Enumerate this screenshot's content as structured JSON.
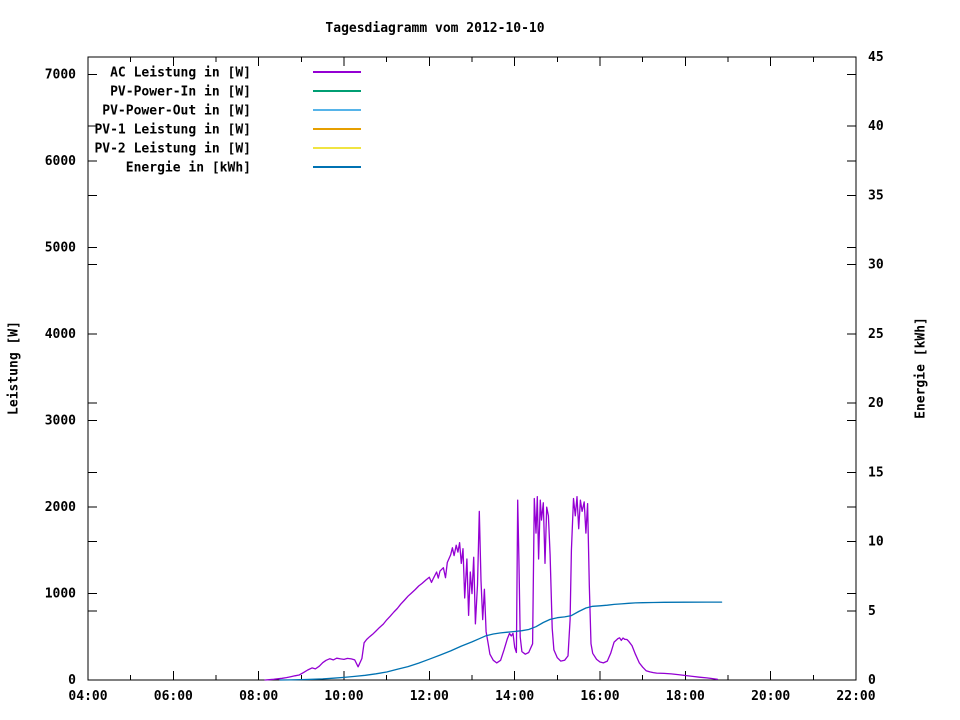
{
  "title": "Tagesdiagramm vom 2012-10-10",
  "chart_data": {
    "type": "line",
    "title": "Tagesdiagramm vom 2012-10-10",
    "grid": false,
    "legend_position": "top-left-inside",
    "x_axis": {
      "unit": "time of day",
      "range_hours": [
        4,
        22
      ],
      "major_tick_step_hours": 2,
      "minor_tick_step_hours": 1,
      "tick_labels": [
        "04:00",
        "06:00",
        "08:00",
        "10:00",
        "12:00",
        "14:00",
        "16:00",
        "18:00",
        "20:00",
        "22:00"
      ]
    },
    "y_left": {
      "label": "Leistung [W]",
      "range": [
        0,
        7200
      ],
      "tick_step": 1000,
      "tick_labels": [
        "0",
        "1000",
        "2000",
        "3000",
        "4000",
        "5000",
        "6000",
        "7000"
      ]
    },
    "y_right": {
      "label": "Energie [kWh]",
      "range": [
        0,
        45
      ],
      "tick_step": 5,
      "tick_labels": [
        "0",
        "5",
        "10",
        "15",
        "20",
        "25",
        "30",
        "35",
        "40",
        "45"
      ]
    },
    "series": [
      {
        "name": "AC Leistung in [W]",
        "color": "#9400D3",
        "axis": "left",
        "points": [
          [
            8.15,
            0
          ],
          [
            8.25,
            3
          ],
          [
            8.35,
            8
          ],
          [
            8.45,
            14
          ],
          [
            8.55,
            20
          ],
          [
            8.65,
            28
          ],
          [
            8.75,
            38
          ],
          [
            8.85,
            48
          ],
          [
            8.95,
            58
          ],
          [
            9.05,
            85
          ],
          [
            9.15,
            115
          ],
          [
            9.25,
            140
          ],
          [
            9.33,
            128
          ],
          [
            9.42,
            160
          ],
          [
            9.5,
            200
          ],
          [
            9.58,
            228
          ],
          [
            9.67,
            246
          ],
          [
            9.75,
            232
          ],
          [
            9.83,
            252
          ],
          [
            9.92,
            244
          ],
          [
            10.0,
            238
          ],
          [
            10.08,
            250
          ],
          [
            10.17,
            244
          ],
          [
            10.25,
            232
          ],
          [
            10.33,
            152
          ],
          [
            10.42,
            248
          ],
          [
            10.47,
            430
          ],
          [
            10.53,
            468
          ],
          [
            10.6,
            500
          ],
          [
            10.67,
            528
          ],
          [
            10.75,
            566
          ],
          [
            10.83,
            606
          ],
          [
            10.92,
            646
          ],
          [
            11.0,
            694
          ],
          [
            11.08,
            736
          ],
          [
            11.17,
            786
          ],
          [
            11.25,
            826
          ],
          [
            11.33,
            876
          ],
          [
            11.42,
            924
          ],
          [
            11.5,
            968
          ],
          [
            11.58,
            1004
          ],
          [
            11.67,
            1046
          ],
          [
            11.75,
            1086
          ],
          [
            11.83,
            1116
          ],
          [
            11.92,
            1156
          ],
          [
            12.0,
            1188
          ],
          [
            12.05,
            1128
          ],
          [
            12.1,
            1180
          ],
          [
            12.17,
            1248
          ],
          [
            12.21,
            1178
          ],
          [
            12.25,
            1258
          ],
          [
            12.33,
            1298
          ],
          [
            12.38,
            1182
          ],
          [
            12.42,
            1358
          ],
          [
            12.5,
            1448
          ],
          [
            12.54,
            1528
          ],
          [
            12.58,
            1438
          ],
          [
            12.63,
            1558
          ],
          [
            12.67,
            1478
          ],
          [
            12.71,
            1588
          ],
          [
            12.75,
            1348
          ],
          [
            12.79,
            1518
          ],
          [
            12.83,
            948
          ],
          [
            12.88,
            1398
          ],
          [
            12.92,
            748
          ],
          [
            12.96,
            1248
          ],
          [
            13.0,
            998
          ],
          [
            13.04,
            1418
          ],
          [
            13.08,
            648
          ],
          [
            13.13,
            1098
          ],
          [
            13.17,
            1948
          ],
          [
            13.21,
            1148
          ],
          [
            13.25,
            698
          ],
          [
            13.29,
            1048
          ],
          [
            13.33,
            558
          ],
          [
            13.38,
            418
          ],
          [
            13.42,
            298
          ],
          [
            13.5,
            228
          ],
          [
            13.58,
            198
          ],
          [
            13.67,
            228
          ],
          [
            13.75,
            348
          ],
          [
            13.83,
            478
          ],
          [
            13.88,
            538
          ],
          [
            13.92,
            508
          ],
          [
            13.96,
            540
          ],
          [
            14.0,
            378
          ],
          [
            14.04,
            318
          ],
          [
            14.07,
            2078
          ],
          [
            14.1,
            1398
          ],
          [
            14.13,
            498
          ],
          [
            14.17,
            328
          ],
          [
            14.25,
            298
          ],
          [
            14.33,
            318
          ],
          [
            14.42,
            418
          ],
          [
            14.46,
            2098
          ],
          [
            14.5,
            1698
          ],
          [
            14.53,
            2118
          ],
          [
            14.56,
            1398
          ],
          [
            14.6,
            2078
          ],
          [
            14.63,
            1848
          ],
          [
            14.67,
            2048
          ],
          [
            14.71,
            1348
          ],
          [
            14.75,
            1998
          ],
          [
            14.79,
            1898
          ],
          [
            14.83,
            1448
          ],
          [
            14.88,
            598
          ],
          [
            14.92,
            348
          ],
          [
            15.0,
            258
          ],
          [
            15.08,
            218
          ],
          [
            15.17,
            228
          ],
          [
            15.25,
            278
          ],
          [
            15.3,
            698
          ],
          [
            15.33,
            1498
          ],
          [
            15.38,
            2098
          ],
          [
            15.42,
            1898
          ],
          [
            15.46,
            2118
          ],
          [
            15.5,
            1748
          ],
          [
            15.54,
            2078
          ],
          [
            15.58,
            1948
          ],
          [
            15.63,
            2058
          ],
          [
            15.67,
            1698
          ],
          [
            15.71,
            2038
          ],
          [
            15.75,
            1098
          ],
          [
            15.79,
            418
          ],
          [
            15.83,
            308
          ],
          [
            15.92,
            238
          ],
          [
            16.0,
            208
          ],
          [
            16.08,
            198
          ],
          [
            16.17,
            218
          ],
          [
            16.25,
            308
          ],
          [
            16.33,
            438
          ],
          [
            16.42,
            478
          ],
          [
            16.46,
            488
          ],
          [
            16.5,
            458
          ],
          [
            16.54,
            485
          ],
          [
            16.58,
            470
          ],
          [
            16.63,
            468
          ],
          [
            16.67,
            448
          ],
          [
            16.75,
            398
          ],
          [
            16.83,
            298
          ],
          [
            16.92,
            198
          ],
          [
            17.0,
            148
          ],
          [
            17.08,
            108
          ],
          [
            17.17,
            94
          ],
          [
            17.25,
            86
          ],
          [
            17.33,
            80
          ],
          [
            17.5,
            76
          ],
          [
            17.67,
            70
          ],
          [
            17.83,
            62
          ],
          [
            18.0,
            52
          ],
          [
            18.17,
            42
          ],
          [
            18.33,
            32
          ],
          [
            18.5,
            24
          ],
          [
            18.6,
            18
          ],
          [
            18.7,
            12
          ],
          [
            18.75,
            8
          ]
        ]
      },
      {
        "name": "PV-Power-In in [W]",
        "color": "#009E73",
        "axis": "left",
        "points": []
      },
      {
        "name": "PV-Power-Out in [W]",
        "color": "#56B4E9",
        "axis": "left",
        "points": []
      },
      {
        "name": "PV-1 Leistung in [W]",
        "color": "#E69F00",
        "axis": "left",
        "points": []
      },
      {
        "name": "PV-2 Leistung in [W]",
        "color": "#F0E442",
        "axis": "left",
        "points": []
      },
      {
        "name": "Energie in [kWh]",
        "color": "#0072B2",
        "axis": "right",
        "points": [
          [
            8.5,
            0
          ],
          [
            8.75,
            0.01
          ],
          [
            9.0,
            0.03
          ],
          [
            9.25,
            0.05
          ],
          [
            9.5,
            0.08
          ],
          [
            9.75,
            0.13
          ],
          [
            10.0,
            0.19
          ],
          [
            10.25,
            0.26
          ],
          [
            10.5,
            0.34
          ],
          [
            10.75,
            0.45
          ],
          [
            11.0,
            0.58
          ],
          [
            11.25,
            0.77
          ],
          [
            11.5,
            0.97
          ],
          [
            11.75,
            1.22
          ],
          [
            12.0,
            1.5
          ],
          [
            12.25,
            1.8
          ],
          [
            12.5,
            2.1
          ],
          [
            12.75,
            2.45
          ],
          [
            13.0,
            2.75
          ],
          [
            13.17,
            2.98
          ],
          [
            13.33,
            3.2
          ],
          [
            13.5,
            3.32
          ],
          [
            13.67,
            3.4
          ],
          [
            13.83,
            3.45
          ],
          [
            14.0,
            3.5
          ],
          [
            14.17,
            3.56
          ],
          [
            14.33,
            3.65
          ],
          [
            14.5,
            3.85
          ],
          [
            14.67,
            4.15
          ],
          [
            14.83,
            4.38
          ],
          [
            15.0,
            4.5
          ],
          [
            15.17,
            4.56
          ],
          [
            15.33,
            4.65
          ],
          [
            15.5,
            4.95
          ],
          [
            15.67,
            5.2
          ],
          [
            15.83,
            5.32
          ],
          [
            16.0,
            5.36
          ],
          [
            16.17,
            5.4
          ],
          [
            16.33,
            5.46
          ],
          [
            16.5,
            5.5
          ],
          [
            16.67,
            5.54
          ],
          [
            16.83,
            5.57
          ],
          [
            17.0,
            5.58
          ],
          [
            17.25,
            5.6
          ],
          [
            17.5,
            5.61
          ],
          [
            18.0,
            5.62
          ],
          [
            18.5,
            5.63
          ],
          [
            18.85,
            5.63
          ]
        ]
      }
    ]
  }
}
